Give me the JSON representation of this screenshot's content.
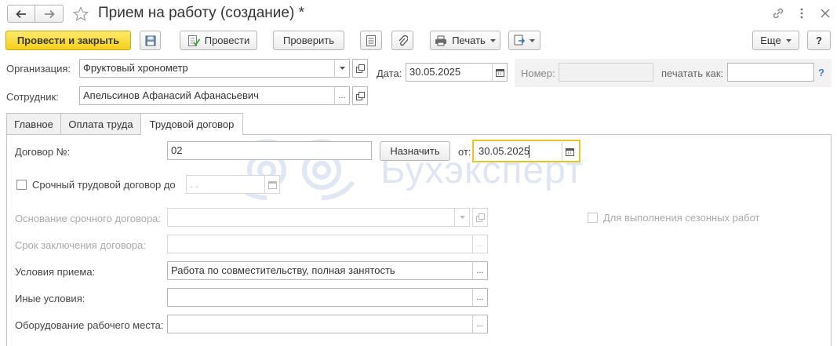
{
  "window": {
    "title": "Прием на работу (создание) *",
    "icons": [
      "back-arrow-icon",
      "forward-arrow-icon",
      "star-icon",
      "link-icon",
      "kebab-menu-icon",
      "close-icon"
    ]
  },
  "toolbar": {
    "post_close": "Провести и закрыть",
    "post": "Провести",
    "check": "Проверить",
    "print": "Печать",
    "more": "Еще",
    "help": "?"
  },
  "header": {
    "org_label": "Организация:",
    "org_value": "Фруктовый хронометр",
    "date_label": "Дата:",
    "date_value": "30.05.2025",
    "number_label": "Номер:",
    "number_value": "",
    "print_as_label": "печатать как:",
    "print_as_value": "",
    "help_mark": "?",
    "employee_label": "Сотрудник:",
    "employee_value": "Апельсинов Афанасий Афанасьевич"
  },
  "tabs": [
    {
      "label": "Главное"
    },
    {
      "label": "Оплата труда"
    },
    {
      "label": "Трудовой договор",
      "active": true
    }
  ],
  "contract": {
    "number_label": "Договор №:",
    "number_value": "02",
    "assign_button": "Назначить",
    "from_label": "от:",
    "from_value": "30.05.2025",
    "fixed_term_label": "Срочный трудовой договор до",
    "fixed_term_date": " .  .",
    "basis_label": "Основание срочного договора:",
    "seasonal_label": "Для выполнения сезонных работ",
    "term_label": "Срок заключения договора:",
    "conditions_label": "Условия приема:",
    "conditions_value": "Работа по совместительству, полная занятость",
    "other_label": "Иные условия:",
    "other_value": "",
    "equipment_label": "Оборудование рабочего места:",
    "equipment_value": ""
  },
  "watermark": "Бухэксперт",
  "colors": {
    "primary": "#f5cf1b",
    "focus": "#e6c52a",
    "watermark": "#dde6f2"
  }
}
